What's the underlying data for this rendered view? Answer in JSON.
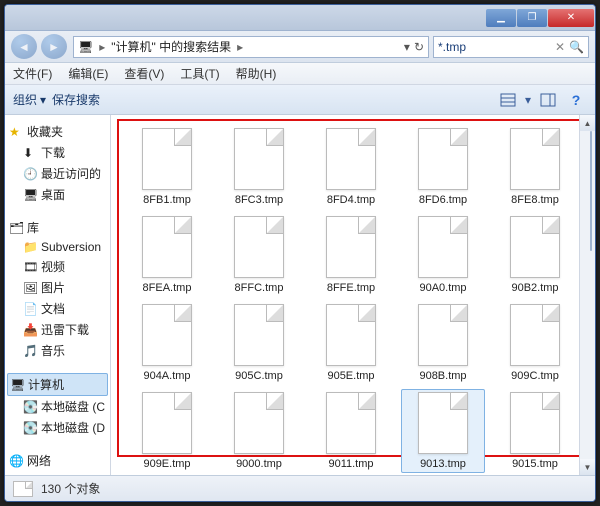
{
  "titlebar": {
    "min": "▁",
    "max": "❐",
    "close": "✕"
  },
  "nav": {
    "back": "◄",
    "fwd": "►",
    "path_root_icon": "🖥",
    "path_text": "\"计算机\" 中的搜索结果",
    "crumb_arrow": "▸",
    "refresh": "↻",
    "dropdown": "▾"
  },
  "search": {
    "value": "*.tmp",
    "clear": "✕",
    "icon": "🔍"
  },
  "menubar": [
    "文件(F)",
    "编辑(E)",
    "查看(V)",
    "工具(T)",
    "帮助(H)"
  ],
  "toolbar": {
    "organize": "组织",
    "save_search": "保存搜索",
    "arrow": "▾"
  },
  "sidebar": {
    "favorites": {
      "label": "收藏夹",
      "items": [
        "下载",
        "最近访问的",
        "桌面"
      ],
      "star": "★"
    },
    "libs": {
      "label": "库",
      "items": [
        "Subversion",
        "视频",
        "图片",
        "文档",
        "迅雷下载",
        "音乐"
      ]
    },
    "computer": {
      "label": "计算机",
      "items": [
        "本地磁盘 (C",
        "本地磁盘 (D"
      ]
    },
    "network": {
      "label": "网络"
    },
    "chev": "▷"
  },
  "files": [
    "8FB1.tmp",
    "8FC3.tmp",
    "8FD4.tmp",
    "8FD6.tmp",
    "8FE8.tmp",
    "8FEA.tmp",
    "8FFC.tmp",
    "8FFE.tmp",
    "90A0.tmp",
    "90B2.tmp",
    "904A.tmp",
    "905C.tmp",
    "905E.tmp",
    "908B.tmp",
    "909C.tmp",
    "909E.tmp",
    "9000.tmp",
    "9011.tmp",
    "9013.tmp",
    "9015.tmp"
  ],
  "selected_file_index": 18,
  "status": {
    "text": "130 个对象"
  }
}
